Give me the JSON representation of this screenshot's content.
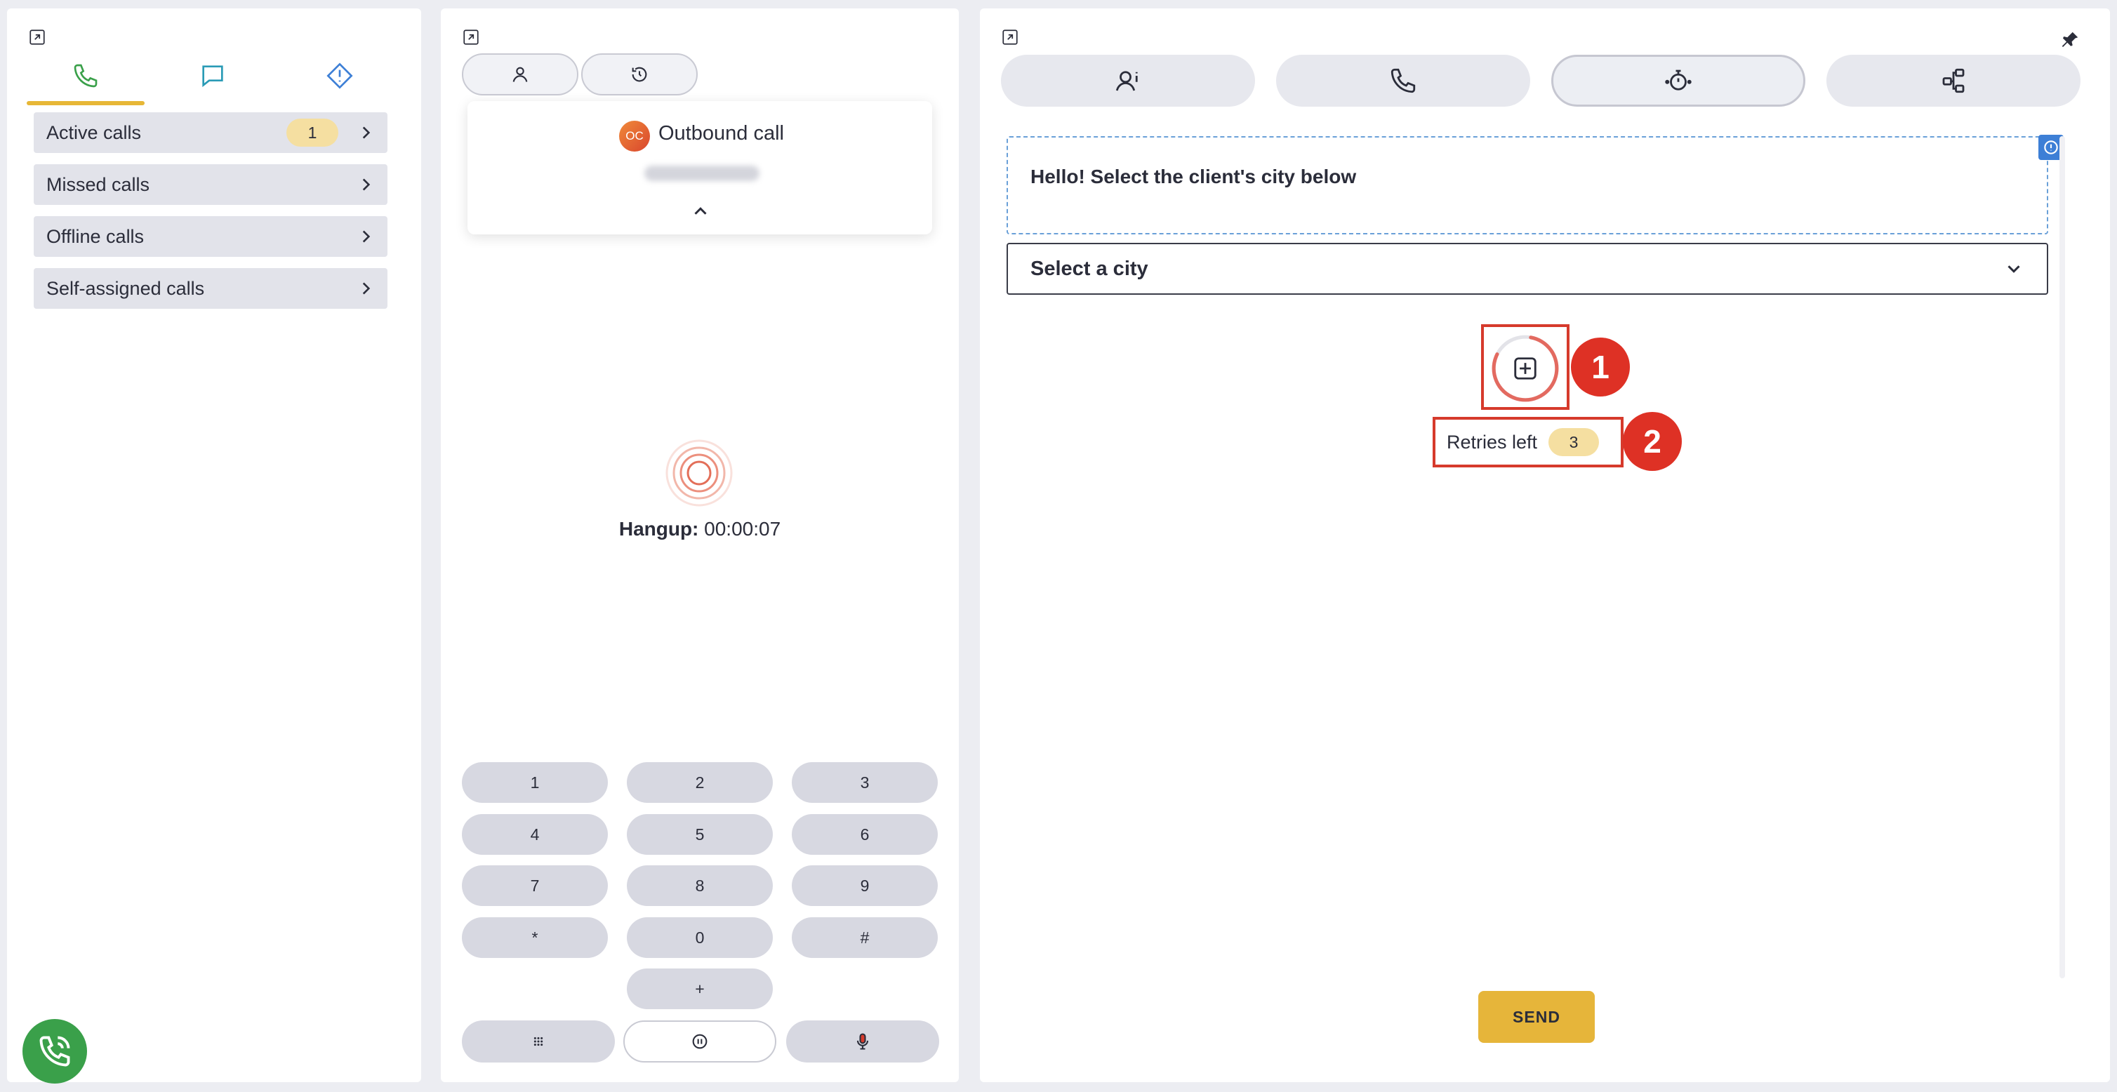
{
  "left_panel": {
    "tabs": [
      {
        "icon": "phone-icon",
        "active": true
      },
      {
        "icon": "chat-icon",
        "active": false
      },
      {
        "icon": "alert-diamond-icon",
        "active": false
      }
    ],
    "call_items": [
      {
        "label": "Active calls",
        "badge": "1"
      },
      {
        "label": "Missed calls"
      },
      {
        "label": "Offline calls"
      },
      {
        "label": "Self-assigned calls"
      }
    ]
  },
  "middle_panel": {
    "call_card": {
      "avatar_initials": "OC",
      "title": "Outbound call"
    },
    "hangup": {
      "label": "Hangup:",
      "time": "00:00:07"
    },
    "keypad": [
      "1",
      "2",
      "3",
      "4",
      "5",
      "6",
      "7",
      "8",
      "9",
      "*",
      "0",
      "#",
      "+"
    ]
  },
  "right_panel": {
    "tabs": [
      {
        "icon": "agent-info-icon"
      },
      {
        "icon": "phone-icon"
      },
      {
        "icon": "timer-icon",
        "active": true
      },
      {
        "icon": "flow-icon"
      }
    ],
    "message": "Hello! Select the client's city below",
    "select": {
      "value": "Select a city"
    },
    "annotations": [
      "1",
      "2"
    ],
    "retries": {
      "label": "Retries left",
      "count": "3"
    },
    "send_label": "SEND"
  },
  "colors": {
    "accent_yellow": "#e7b736",
    "badge_yellow": "#f5dfa1",
    "annotation_red": "#de3125",
    "call_green": "#3aa04a",
    "info_blue": "#3d7fd6"
  }
}
